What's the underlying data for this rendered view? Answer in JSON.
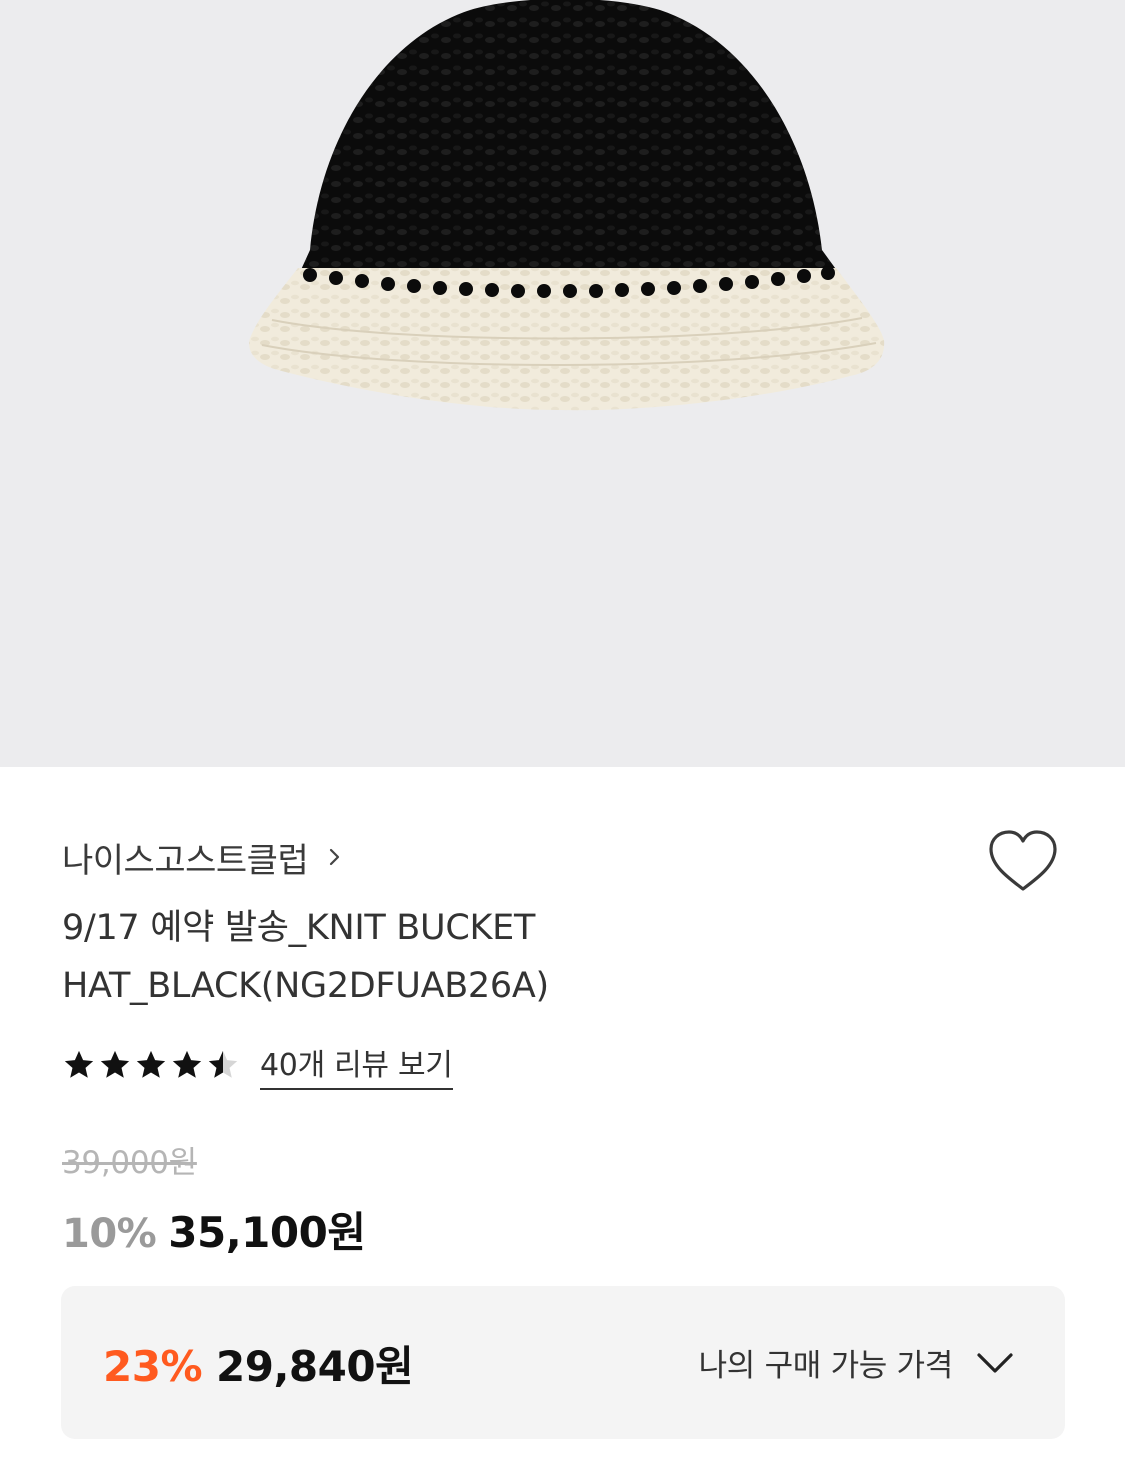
{
  "product": {
    "image_alt": "",
    "brand": "나이스고스트클럽",
    "title_line1": "9/17 예약 발송_KNIT BUCKET",
    "title_line2": "HAT_BLACK(NG2DFUAB26A)",
    "rating": 4.5,
    "review_link": "40개 리뷰 보기",
    "original_price": "39,000원",
    "discount_rate": "10%",
    "sale_price": "35,100원"
  },
  "my_price": {
    "discount_rate": "23%",
    "amount": "29,840원",
    "label": "나의 구매 가능 가격"
  },
  "icons": {
    "brand_chevron": "chevron-right-icon",
    "wishlist": "heart-outline-icon",
    "rating_star": "star-icon",
    "expand": "chevron-down-icon"
  },
  "colors": {
    "hero_background": "#ececee",
    "accent_discount": "#ff5a1f",
    "muted_discount": "#9a9a9a",
    "strikethrough_price": "#b5b5b5",
    "box_background": "#f4f4f4"
  }
}
